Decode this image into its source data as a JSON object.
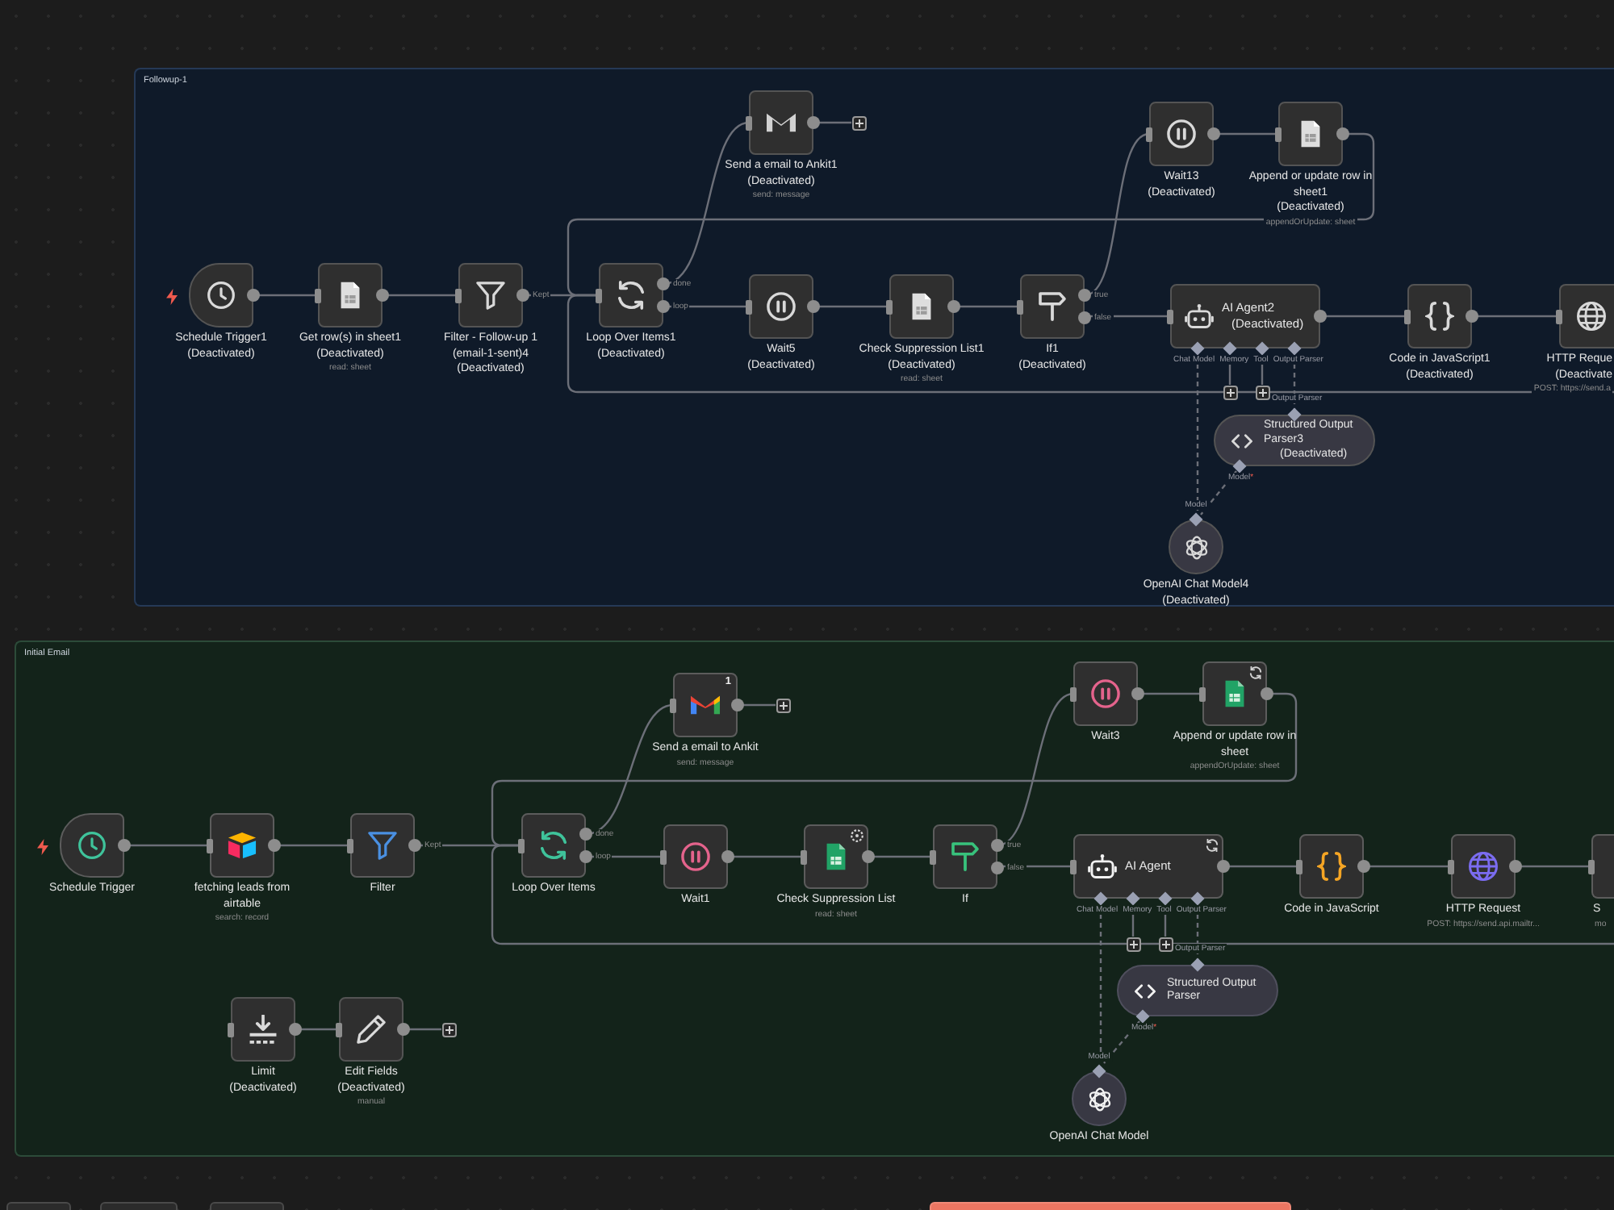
{
  "groups": [
    {
      "title": "Followup-1",
      "color": "#0f1a29",
      "nodes": [
        {
          "kind": "schedule",
          "name": "Schedule Trigger1",
          "note": "(Deactivated)",
          "disabled": true
        },
        {
          "kind": "sheets",
          "name": "Get row(s) in sheet1",
          "note": "(Deactivated)",
          "subtitle": "read: sheet",
          "disabled": true
        },
        {
          "kind": "filter",
          "name": "Filter - Follow-up 1 (email-1-sent)4",
          "note": "(Deactivated)",
          "disabled": true,
          "outputs": [
            "Kept"
          ]
        },
        {
          "kind": "loop",
          "name": "Loop Over Items1",
          "note": "(Deactivated)",
          "disabled": true,
          "outputs": [
            "done",
            "loop"
          ]
        },
        {
          "kind": "gmail",
          "name": "Send a email to Ankit1",
          "note": "(Deactivated)",
          "subtitle": "send: message",
          "disabled": true
        },
        {
          "kind": "wait",
          "name": "Wait5",
          "note": "(Deactivated)",
          "disabled": true
        },
        {
          "kind": "sheets",
          "name": "Check Suppression List1",
          "note": "(Deactivated)",
          "subtitle": "read: sheet",
          "disabled": true
        },
        {
          "kind": "if",
          "name": "If1",
          "note": "(Deactivated)",
          "disabled": true,
          "outputs": [
            "true",
            "false"
          ]
        },
        {
          "kind": "wait",
          "name": "Wait13",
          "note": "(Deactivated)",
          "disabled": true
        },
        {
          "kind": "sheets",
          "name": "Append or update row in sheet1",
          "note": "(Deactivated)",
          "subtitle": "appendOrUpdate: sheet",
          "disabled": true
        },
        {
          "kind": "agent",
          "name": "AI Agent2",
          "note": "(Deactivated)",
          "disabled": true,
          "ports": [
            "Chat Model",
            "Memory",
            "Tool",
            "Output Parser"
          ]
        },
        {
          "kind": "code",
          "name": "Code in JavaScript1",
          "note": "(Deactivated)",
          "disabled": true
        },
        {
          "kind": "http",
          "name": "HTTP Reque",
          "note": "(Deactivate",
          "subtitle": "POST: https://send.a",
          "disabled": true
        },
        {
          "kind": "parser",
          "name": "Structured Output Parser3",
          "note": "(Deactivated)",
          "disabled": true,
          "output_label": "Output Parser",
          "input_label": "Model",
          "input_mark": "*"
        },
        {
          "kind": "openai",
          "name": "OpenAI Chat Model4",
          "note": "(Deactivated)",
          "disabled": true,
          "output_label": "Model"
        }
      ]
    },
    {
      "title": "Initial Email",
      "color": "#13231a",
      "nodes": [
        {
          "kind": "schedule",
          "name": "Schedule Trigger",
          "disabled": false
        },
        {
          "kind": "airtable",
          "name": "fetching leads from airtable",
          "subtitle": "search: record",
          "disabled": false
        },
        {
          "kind": "filter",
          "name": "Filter",
          "disabled": false,
          "outputs": [
            "Kept"
          ]
        },
        {
          "kind": "loop",
          "name": "Loop Over Items",
          "disabled": false,
          "outputs": [
            "done",
            "loop"
          ]
        },
        {
          "kind": "gmail",
          "name": "Send a email to Ankit",
          "subtitle": "send: message",
          "disabled": false,
          "badge": "1"
        },
        {
          "kind": "wait",
          "name": "Wait1",
          "disabled": false
        },
        {
          "kind": "sheets",
          "name": "Check Suppression List",
          "subtitle": "read: sheet",
          "disabled": false,
          "indicator": {
            "kind": "settings"
          }
        },
        {
          "kind": "if",
          "name": "If",
          "disabled": false,
          "outputs": [
            "true",
            "false"
          ]
        },
        {
          "kind": "wait",
          "name": "Wait3",
          "disabled": false
        },
        {
          "kind": "sheets",
          "name": "Append or update row in sheet",
          "subtitle": "appendOrUpdate: sheet",
          "disabled": false,
          "indicator": {
            "kind": "retry"
          }
        },
        {
          "kind": "agent",
          "name": "AI Agent",
          "disabled": false,
          "indicator": {
            "kind": "retry"
          },
          "ports": [
            "Chat Model",
            "Memory",
            "Tool",
            "Output Parser"
          ]
        },
        {
          "kind": "code",
          "name": "Code in JavaScript",
          "disabled": false
        },
        {
          "kind": "http",
          "name": "HTTP Request",
          "subtitle": "POST: https://send.api.mailtr...",
          "disabled": false
        },
        {
          "kind": "other",
          "name": "S",
          "subtitle": "mo"
        },
        {
          "kind": "parser",
          "name": "Structured Output Parser",
          "disabled": false,
          "output_label": "Output Parser",
          "input_label": "Model",
          "input_mark": "*"
        },
        {
          "kind": "openai",
          "name": "OpenAI Chat Model",
          "disabled": false,
          "output_label": "Model"
        },
        {
          "kind": "limit",
          "name": "Limit",
          "note": "(Deactivated)",
          "disabled": true
        },
        {
          "kind": "set",
          "name": "Edit Fields",
          "note": "(Deactivated)",
          "subtitle": "manual",
          "disabled": true
        }
      ]
    }
  ]
}
